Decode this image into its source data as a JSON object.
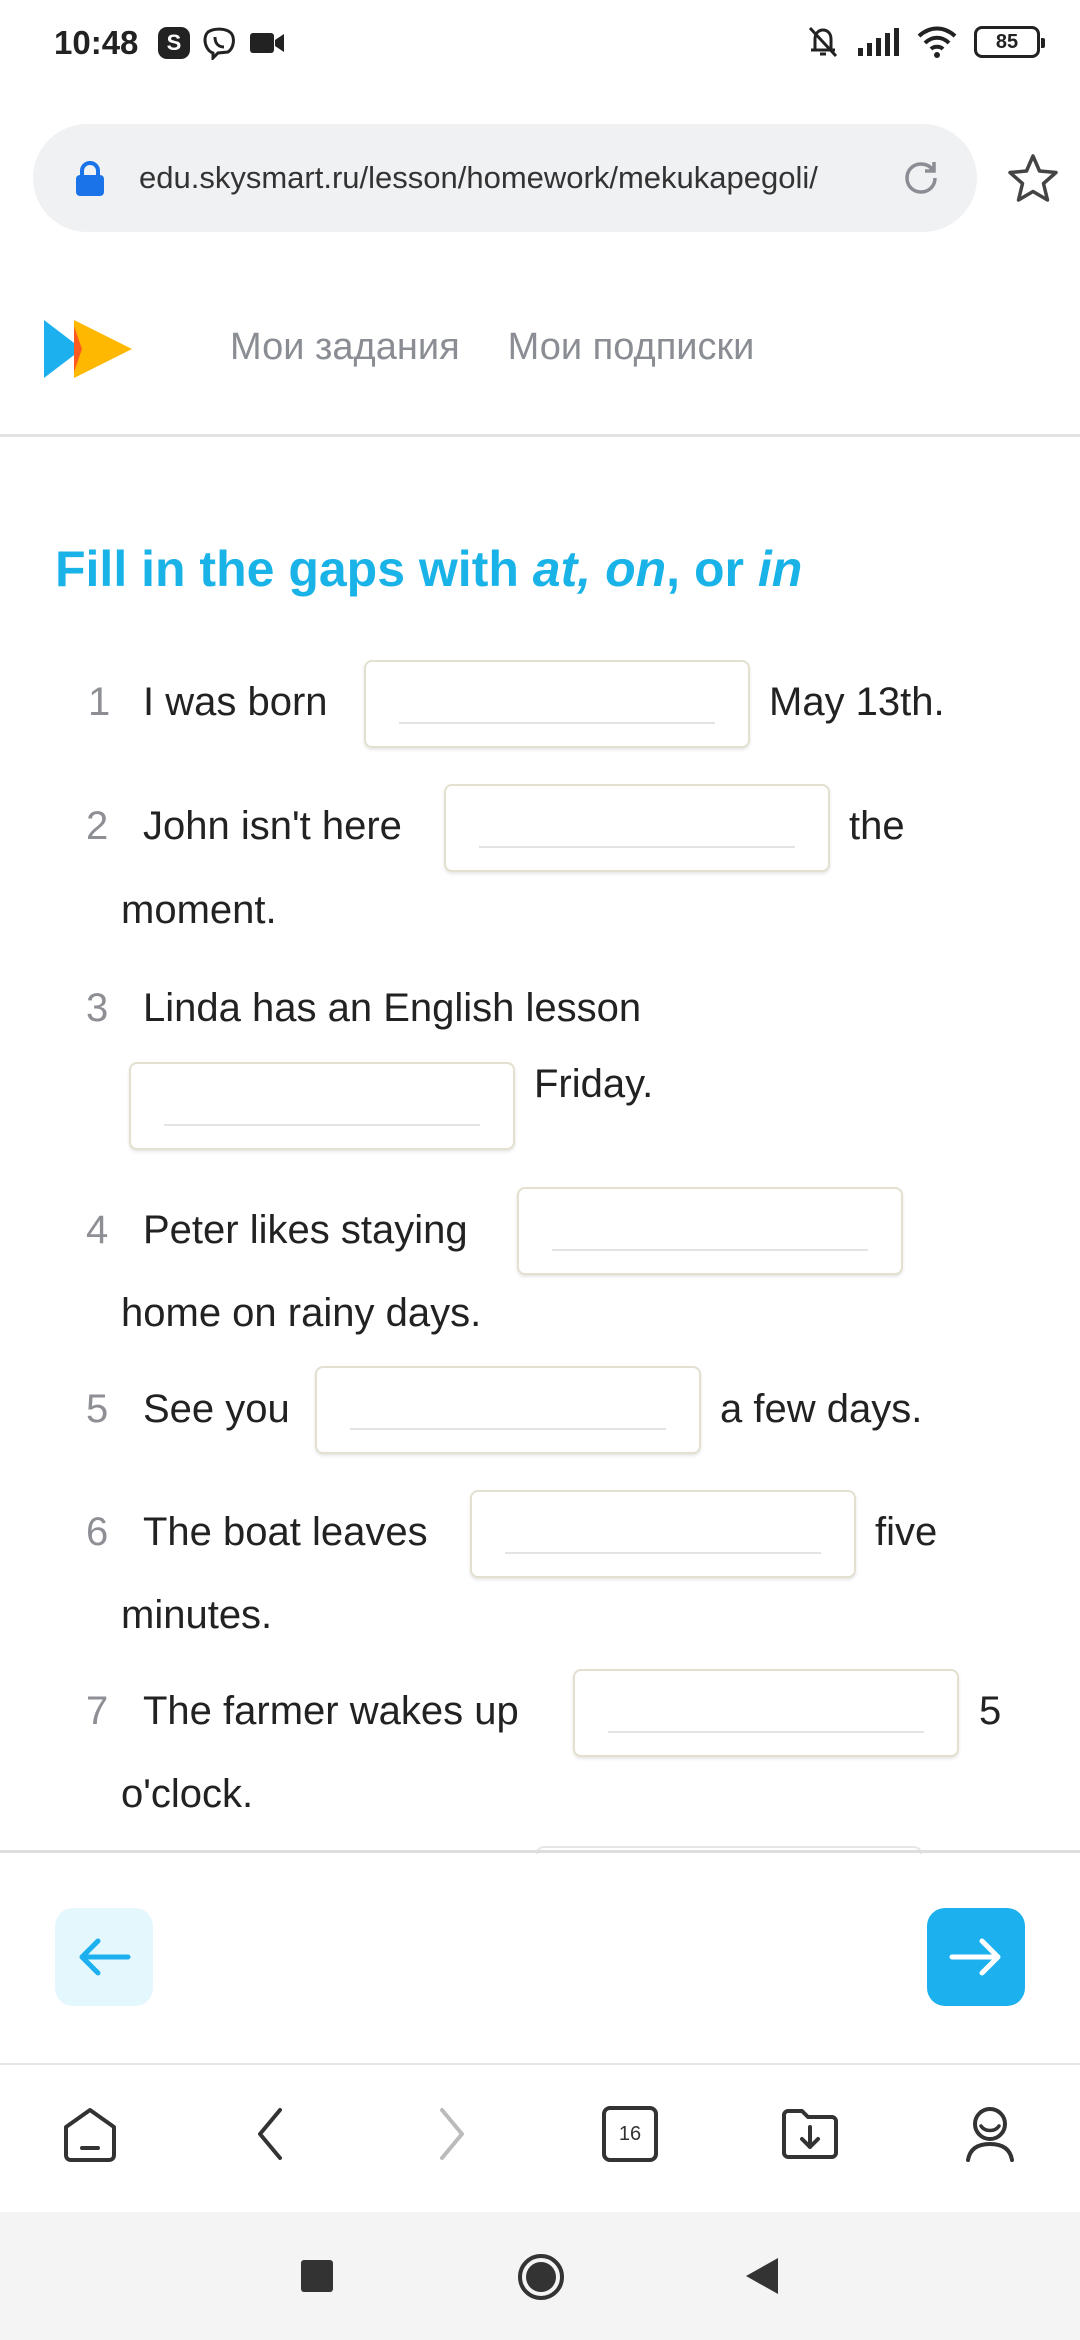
{
  "status_bar": {
    "time": "10:48",
    "left_icons": [
      "skype-icon",
      "viber-icon",
      "video-camera-icon"
    ],
    "right_icons": [
      "bell-muted-icon",
      "signal-icon",
      "wifi-icon",
      "battery-icon"
    ],
    "battery": "85"
  },
  "browser": {
    "url": "edu.skysmart.ru/lesson/homework/mekukapegoli/",
    "tabs_count": "16"
  },
  "site": {
    "nav": [
      "Мои задания",
      "Мои подписки"
    ]
  },
  "task": {
    "title_prefix": "Fill in the gaps with ",
    "title_at": "at,",
    "title_on": "on",
    "title_comma": ", or ",
    "title_in": "in"
  },
  "questions": [
    {
      "num": "1",
      "before": "I was born",
      "after": "May 13th.",
      "cont": ""
    },
    {
      "num": "2",
      "before": "John isn't here",
      "after": "the",
      "cont": "moment."
    },
    {
      "num": "3",
      "before": "Linda has an English lesson",
      "after": "Friday.",
      "cont": ""
    },
    {
      "num": "4",
      "before": "Peter likes staying",
      "after": "",
      "cont": "home on rainy days."
    },
    {
      "num": "5",
      "before": "See you",
      "after": "a few days.",
      "cont": ""
    },
    {
      "num": "6",
      "before": "The boat leaves",
      "after": "five",
      "cont": "minutes."
    },
    {
      "num": "7",
      "before": "The farmer wakes up",
      "after": "5",
      "cont": "o'clock."
    }
  ],
  "colors": {
    "accent": "#1ab3e8",
    "next_button": "#1cb0ef",
    "prev_button_bg": "#e3f7fc"
  }
}
